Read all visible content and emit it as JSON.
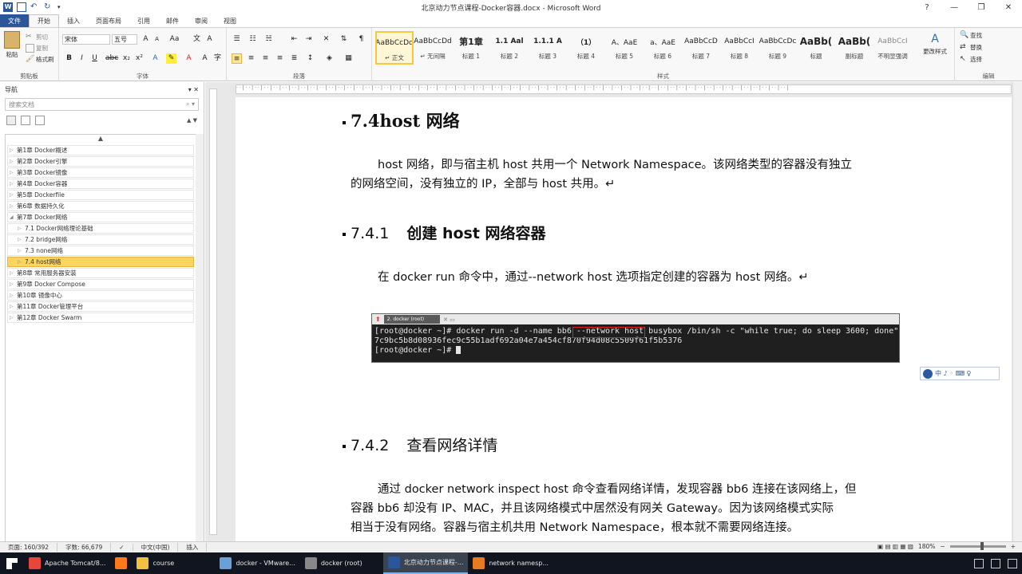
{
  "window": {
    "title": "北京动力节点课程-Docker容器.docx - Microsoft Word",
    "controls": [
      "?",
      "—",
      "❐",
      "✕"
    ]
  },
  "ribbon_tabs": [
    "文件",
    "开始",
    "插入",
    "页面布局",
    "引用",
    "邮件",
    "审阅",
    "视图"
  ],
  "ribbon": {
    "clipboard": {
      "paste": "粘贴",
      "cut": "剪切",
      "copy": "复制",
      "format_painter": "格式刷",
      "label": "剪贴板"
    },
    "font": {
      "family": "宋体",
      "size": "五号",
      "label": "字体"
    },
    "paragraph": {
      "label": "段落"
    },
    "styles": {
      "label": "样式",
      "items": [
        {
          "preview": "AaBbCcDd",
          "name": "↵ 正文"
        },
        {
          "preview": "AaBbCcDd",
          "name": "↵ 无间隔"
        },
        {
          "preview": "第1章",
          "name": "标题 1"
        },
        {
          "preview": "1.1 Aal",
          "name": "标题 2"
        },
        {
          "preview": "1.1.1 A",
          "name": "标题 3"
        },
        {
          "preview": "（1）",
          "name": "标题 4"
        },
        {
          "preview": "A、AaE",
          "name": "标题 5"
        },
        {
          "preview": "a、AaE",
          "name": "标题 6"
        },
        {
          "preview": "AaBbCcD",
          "name": "标题 7"
        },
        {
          "preview": "AaBbCcI",
          "name": "标题 8"
        },
        {
          "preview": "AaBbCcDc",
          "name": "标题 9"
        },
        {
          "preview": "AaBb(",
          "name": "标题"
        },
        {
          "preview": "AaBb(",
          "name": "副标题"
        },
        {
          "preview": "AaBbCcI",
          "name": "不明显强调"
        }
      ],
      "change_styles": "更改样式"
    },
    "editing": {
      "find": "查找",
      "replace": "替换",
      "select": "选择",
      "label": "编辑"
    }
  },
  "nav": {
    "title": "导航",
    "search_placeholder": "搜索文档",
    "items": [
      {
        "label": "第1章 Docker概述",
        "level": 1
      },
      {
        "label": "第2章  Docker引擎",
        "level": 1
      },
      {
        "label": "第3章 Docker镜像",
        "level": 1
      },
      {
        "label": "第4章 Docker容器",
        "level": 1
      },
      {
        "label": "第5章 Dockerfile",
        "level": 1
      },
      {
        "label": "第6章 数据持久化",
        "level": 1
      },
      {
        "label": "第7章 Docker网络",
        "level": 1
      },
      {
        "label": "7.1 Docker网络理论基础",
        "level": 2
      },
      {
        "label": "7.2 bridge网络",
        "level": 2
      },
      {
        "label": "7.3 none网络",
        "level": 2
      },
      {
        "label": "7.4 host网络",
        "level": 2
      },
      {
        "label": "第8章 常用服务器安装",
        "level": 1
      },
      {
        "label": "第9章 Docker Compose",
        "level": 1
      },
      {
        "label": "第10章 镜像中心",
        "level": 1
      },
      {
        "label": "第11章 Docker管理平台",
        "level": 1
      },
      {
        "label": "第12章 Docker Swarm",
        "level": 1
      }
    ]
  },
  "doc": {
    "h_74": "7.4host 网络",
    "p1_line1": "host 网络，即与宿主机 host 共用一个 Network Namespace。该网络类型的容器没有独立",
    "p1_line2": "的网络空间，没有独立的 IP，全部与 host 共用。↵",
    "h_741_num": "7.4.1",
    "h_741_text": "创建 host 网络容器",
    "p2": "在 docker run 命令中，通过--network host 选项指定创建的容器为 host 网络。↵",
    "terminal": {
      "tab_label": "2. docker (root)",
      "line1": "[root@docker ~]# docker run -d --name bb6 --network host busybox /bin/sh -c \"while true; do sleep 3600; done\"",
      "line2": "7c9bc5b8d08936fec9c55b1adf692a04e7a454cf870f94d08c5509f61f5b5376",
      "line3": "[root@docker ~]# "
    },
    "ime_text": "中 ♪ ◦ ⌨ ♀",
    "h_742_num": "7.4.2",
    "h_742_text": "查看网络详情",
    "p3_line1": "通过 docker network inspect host 命令查看网络详情，发现容器 bb6 连接在该网络上，但",
    "p3_line2": "容器 bb6 却没有 IP、MAC，并且该网络模式中居然没有网关 Gateway。因为该网络模式实际",
    "p3_line3": "相当于没有网络。容器与宿主机共用 Network Namespace，根本就不需要网络连接。"
  },
  "statusbar": {
    "page": "页面: 160/392",
    "words": "字数: 66,679",
    "language": "中文(中国)",
    "mode": "插入",
    "zoom": "180%",
    "zoom_fraction": 0.58
  },
  "taskbar": [
    {
      "label": "Apache Tomcat/8...",
      "icon": "chrome-icon",
      "color": "#e8453c"
    },
    {
      "label": "",
      "icon": "firefox-icon",
      "color": "#ff7a1a"
    },
    {
      "label": "course",
      "icon": "folder-icon",
      "color": "#f0c040"
    },
    {
      "label": "docker - VMware...",
      "icon": "vmware-icon",
      "color": "#6aa0d8"
    },
    {
      "label": "docker (root)",
      "icon": "terminal-icon",
      "color": "#888888"
    },
    {
      "label": "北京动力节点课程-...",
      "icon": "word-icon",
      "color": "#2b579a"
    },
    {
      "label": "network namesp...",
      "icon": "xmind-icon",
      "color": "#e87a20"
    }
  ]
}
